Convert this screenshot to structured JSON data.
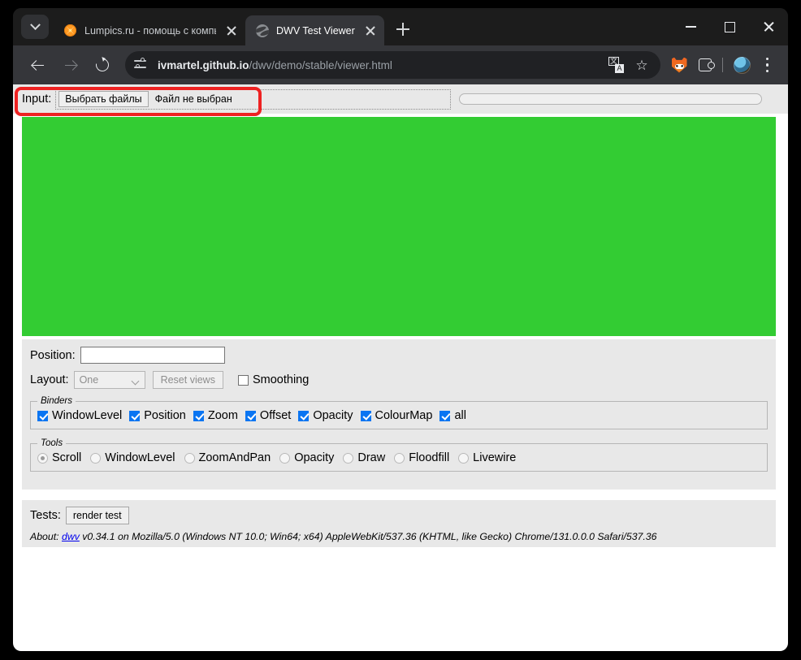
{
  "browser": {
    "tab_list_icon": "chevron-down-icon",
    "tabs": [
      {
        "title": "Lumpics.ru - помощь с компью",
        "favicon": "orange-icon",
        "active": false
      },
      {
        "title": "DWV Test Viewer",
        "favicon": "globe-icon",
        "active": true
      }
    ],
    "new_tab_icon": "plus-icon",
    "window_controls": {
      "minimize": "minimize-icon",
      "maximize": "maximize-icon",
      "close": "close-icon"
    },
    "toolbar": {
      "back_icon": "arrow-left-icon",
      "forward_icon": "arrow-right-icon",
      "reload_icon": "reload-icon",
      "site_info_icon": "page-settings-icon",
      "url_host": "ivmartel.github.io",
      "url_path": "/dwv/demo/stable/viewer.html",
      "translate_icon": "translate-icon",
      "bookmark_icon": "star-icon",
      "metamask_icon": "fox-icon",
      "extensions_icon": "puzzle-icon",
      "profile_icon": "avatar-icon",
      "menu_icon": "three-dots-icon"
    }
  },
  "page": {
    "input": {
      "label": "Input:",
      "choose_files_button": "Выбрать файлы",
      "file_status": "Файл не выбран",
      "progress_value": 0
    },
    "canvas": {
      "color": "#33cc33"
    },
    "controls": {
      "position_label": "Position:",
      "position_value": "",
      "layout_label": "Layout:",
      "layout_value": "One",
      "layout_options": [
        "One"
      ],
      "reset_views_button": "Reset views",
      "smoothing_label": "Smoothing",
      "smoothing_checked": false,
      "binders": {
        "legend": "Binders",
        "items": [
          {
            "label": "WindowLevel",
            "checked": true
          },
          {
            "label": "Position",
            "checked": true
          },
          {
            "label": "Zoom",
            "checked": true
          },
          {
            "label": "Offset",
            "checked": true
          },
          {
            "label": "Opacity",
            "checked": true
          },
          {
            "label": "ColourMap",
            "checked": true
          },
          {
            "label": "all",
            "checked": true
          }
        ]
      },
      "tools": {
        "legend": "Tools",
        "items": [
          {
            "label": "Scroll",
            "selected": true
          },
          {
            "label": "WindowLevel",
            "selected": false
          },
          {
            "label": "ZoomAndPan",
            "selected": false
          },
          {
            "label": "Opacity",
            "selected": false
          },
          {
            "label": "Draw",
            "selected": false
          },
          {
            "label": "Floodfill",
            "selected": false
          },
          {
            "label": "Livewire",
            "selected": false
          }
        ]
      }
    },
    "tests": {
      "label": "Tests:",
      "render_test_button": "render test",
      "about_prefix": "About:",
      "about_link": "dwv",
      "about_text": "v0.34.1 on Mozilla/5.0 (Windows NT 10.0; Win64; x64) AppleWebKit/537.36 (KHTML, like Gecko) Chrome/131.0.0.0 Safari/537.36"
    },
    "highlight": {
      "color": "#ee2222"
    }
  }
}
